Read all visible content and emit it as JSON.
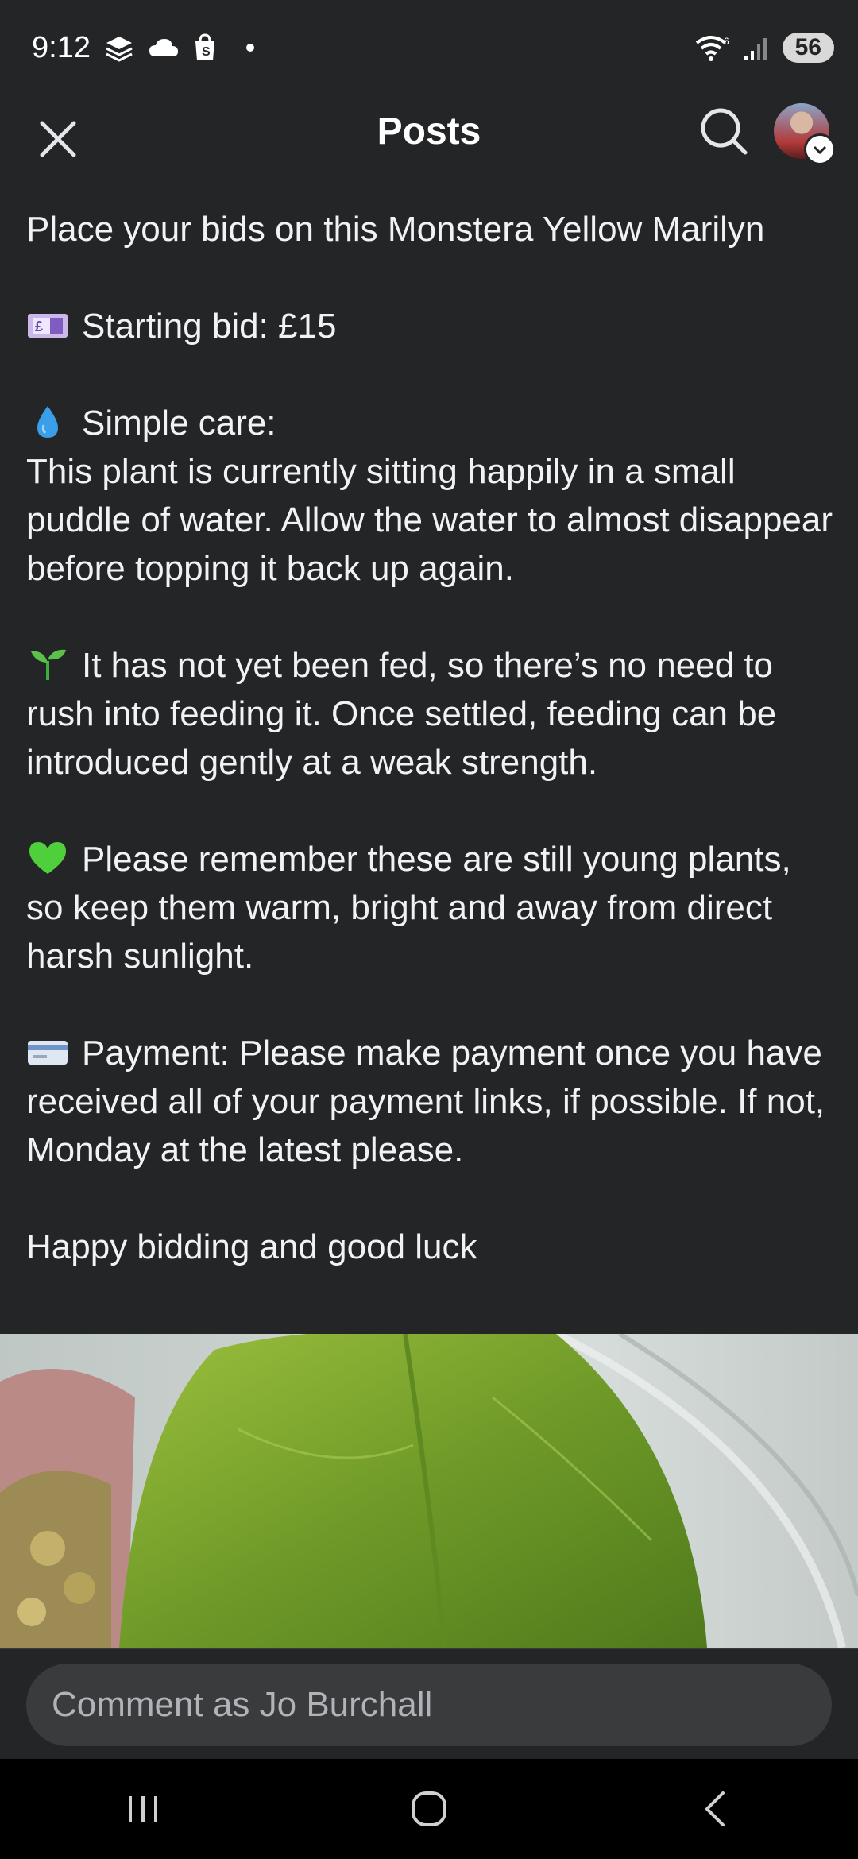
{
  "status_bar": {
    "time": "9:12",
    "battery": "56",
    "icons": [
      "layers-icon",
      "cloud-icon",
      "shopping-bag-icon",
      "wifi-icon",
      "signal-icon"
    ]
  },
  "header": {
    "title": "Posts"
  },
  "post": {
    "title_line": "Place your bids on this Monstera Yellow Marilyn",
    "starting_bid": "Starting bid: £15",
    "care_heading": "Simple care:",
    "care_text": "This plant is currently sitting happily in a small puddle of water. Allow the water to almost disappear before topping it back up again.",
    "feeding_text": "It has not yet been fed, so there’s no need to rush into feeding it. Once settled, feeding can be introduced gently at a weak strength.",
    "young_plants_text": "Please remember these are still young plants, so keep them warm, bright and away from direct harsh sunlight.",
    "payment_text": "Payment: Please make payment once you have received all of your payment links, if possible. If not, Monday at the latest please.",
    "closing_text": "Happy bidding and good luck"
  },
  "comment": {
    "placeholder": "Comment as Jo Burchall"
  },
  "colors": {
    "background": "#242526",
    "input_bg": "#3a3b3c",
    "leaf_green": "#7fa630"
  }
}
